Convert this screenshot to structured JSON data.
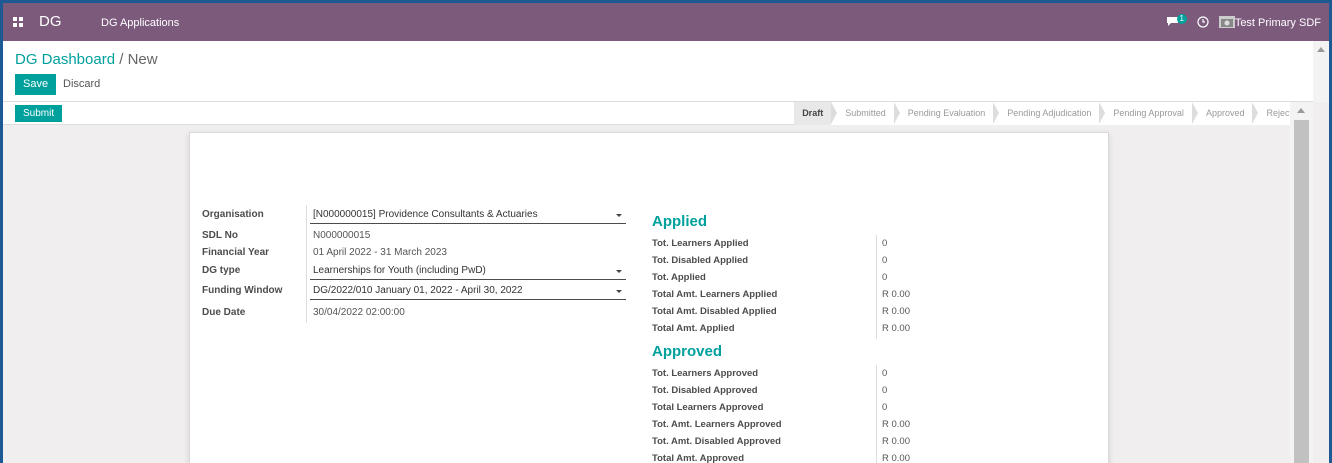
{
  "navbar": {
    "brand": "DG",
    "app_menu": "DG Applications",
    "notification_count": "1",
    "user_name": "Test Primary SDF"
  },
  "control_panel": {
    "breadcrumb_parent": "DG Dashboard",
    "breadcrumb_sep": " / ",
    "breadcrumb_current": "New",
    "save_label": "Save",
    "discard_label": "Discard"
  },
  "statusbar": {
    "submit_label": "Submit",
    "stages": [
      "Draft",
      "Submitted",
      "Pending Evaluation",
      "Pending Adjudication",
      "Pending Approval",
      "Approved",
      "Rejected"
    ],
    "active_stage": "Draft"
  },
  "form": {
    "organisation": {
      "label": "Organisation",
      "value": "[N000000015] Providence Consultants & Actuaries"
    },
    "sdl_no": {
      "label": "SDL No",
      "value": "N000000015"
    },
    "financial_year": {
      "label": "Financial Year",
      "value": "01 April 2022 - 31 March 2023"
    },
    "dg_type": {
      "label": "DG type",
      "value": "Learnerships for Youth (including PwD)"
    },
    "funding_window": {
      "label": "Funding Window",
      "value": "DG/2022/010 January 01, 2022 - April 30, 2022"
    },
    "due_date": {
      "label": "Due Date",
      "value": "30/04/2022 02:00:00"
    }
  },
  "applied": {
    "title": "Applied",
    "rows": [
      {
        "label": "Tot. Learners Applied",
        "value": "0"
      },
      {
        "label": "Tot. Disabled Applied",
        "value": "0"
      },
      {
        "label": "Tot. Applied",
        "value": "0"
      },
      {
        "label": "Total Amt. Learners Applied",
        "value": "R 0.00"
      },
      {
        "label": "Total Amt. Disabled Applied",
        "value": "R 0.00"
      },
      {
        "label": "Total Amt. Applied",
        "value": "R 0.00"
      }
    ]
  },
  "approved": {
    "title": "Approved",
    "rows": [
      {
        "label": "Tot. Learners Approved",
        "value": "0"
      },
      {
        "label": "Tot. Disabled Approved",
        "value": "0"
      },
      {
        "label": "Total Learners Approved",
        "value": "0"
      },
      {
        "label": "Tot. Amt. Learners Approved",
        "value": "R 0.00"
      },
      {
        "label": "Tot. Amt. Disabled Approved",
        "value": "R 0.00"
      },
      {
        "label": "Total Amt. Approved",
        "value": "R 0.00"
      }
    ]
  },
  "colors": {
    "navbar": "#7c5a7c",
    "accent": "#00a09d"
  }
}
